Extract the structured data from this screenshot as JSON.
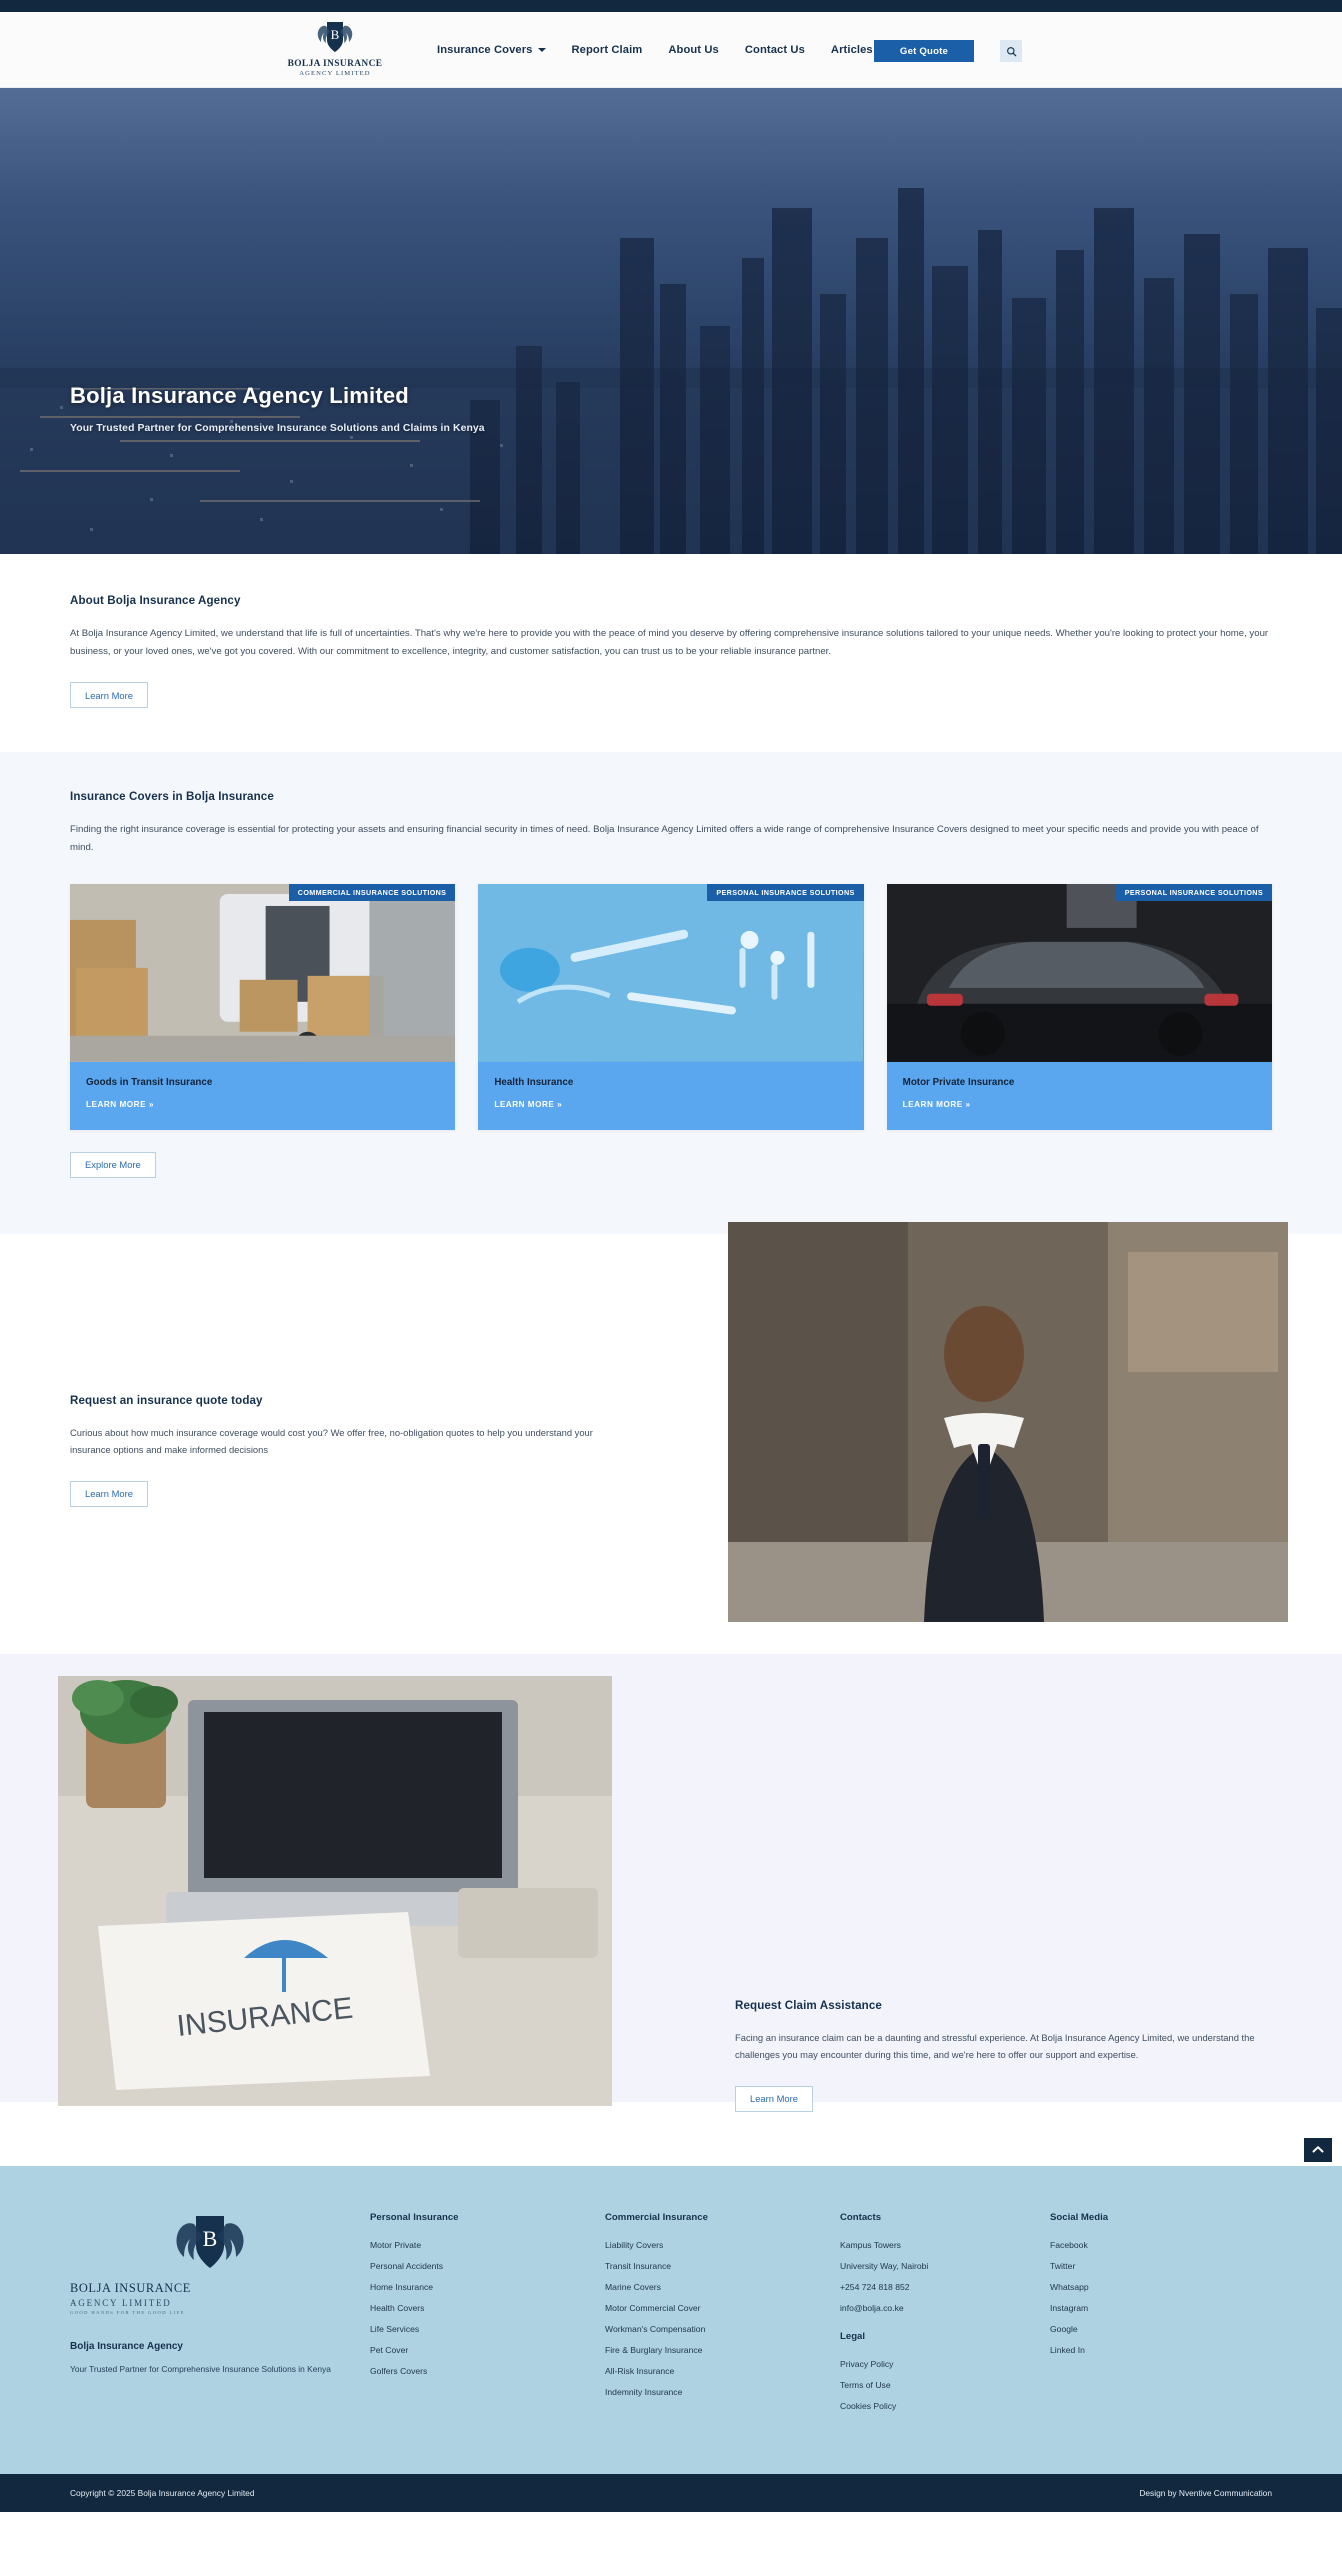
{
  "brand": {
    "logo_line1": "BOLJA INSURANCE",
    "logo_line2": "AGENCY LIMITED",
    "logo_tagline": "GOOD HANDS FOR THE GOOD LIFE",
    "monogram": "B"
  },
  "nav": {
    "items": [
      {
        "label": "Insurance Covers",
        "has_dropdown": true
      },
      {
        "label": "Report Claim",
        "has_dropdown": false
      },
      {
        "label": "About Us",
        "has_dropdown": false
      },
      {
        "label": "Contact Us",
        "has_dropdown": false
      },
      {
        "label": "Articles",
        "has_dropdown": false
      }
    ],
    "quote_button": "Get Quote",
    "search_icon": "search-icon"
  },
  "hero": {
    "title": "Bolja Insurance Agency Limited",
    "subtitle": "Your Trusted Partner for Comprehensive Insurance Solutions and Claims in Kenya"
  },
  "about": {
    "title": "About Bolja Insurance Agency",
    "paragraph": "At Bolja Insurance Agency Limited, we understand that life is full of uncertainties. That's why we're here to provide you with the peace of mind you deserve by offering comprehensive insurance solutions tailored to your unique needs. Whether you're looking to protect your home, your business, or your loved ones, we've got you covered. With our commitment to excellence, integrity, and customer satisfaction, you can trust us to be your reliable insurance partner.",
    "button": "Learn More"
  },
  "covers": {
    "title": "Insurance Covers in Bolja Insurance",
    "paragraph": "Finding the right insurance coverage is essential for protecting your assets and ensuring financial security in times of need. Bolja Insurance Agency Limited offers a wide range of comprehensive Insurance Covers designed to meet your specific needs and provide you with peace of mind.",
    "cards": [
      {
        "badge": "COMMERCIAL INSURANCE SOLUTIONS",
        "title": "Goods in Transit Insurance",
        "link": "LEARN MORE »"
      },
      {
        "badge": "PERSONAL INSURANCE SOLUTIONS",
        "title": "Health Insurance",
        "link": "LEARN MORE »"
      },
      {
        "badge": "PERSONAL INSURANCE SOLUTIONS",
        "title": "Motor Private Insurance",
        "link": "LEARN MORE »"
      }
    ],
    "explore_button": "Explore More"
  },
  "quote": {
    "title": "Request an insurance quote today",
    "paragraph": "Curious about how much insurance coverage would cost you? We offer free, no-obligation quotes to help you understand your insurance options and make informed decisions",
    "button": "Learn More"
  },
  "claim": {
    "title": "Request Claim Assistance",
    "paragraph": "Facing an insurance claim can be a daunting and stressful experience. At Bolja Insurance Agency Limited, we understand the challenges you may encounter during this time, and we're here to offer our support and expertise.",
    "button": "Learn More"
  },
  "footer": {
    "brand_title": "Bolja Insurance Agency",
    "brand_sub": "Your Trusted Partner for Comprehensive Insurance Solutions in Kenya",
    "personal": {
      "heading": "Personal Insurance",
      "links": [
        "Motor Private",
        "Personal Accidents",
        "Home Insurance",
        "Health Covers",
        "Life Services",
        "Pet Cover",
        "Golfers Covers"
      ]
    },
    "commercial": {
      "heading": "Commercial Insurance",
      "links": [
        "Liability Covers",
        "Transit Insurance",
        "Marine Covers",
        "Motor Commercial Cover",
        "Workman's Compensation",
        "Fire & Burglary Insurance",
        "All-Risk Insurance",
        "Indemnity Insurance"
      ]
    },
    "contacts": {
      "heading": "Contacts",
      "links": [
        "Kampus Towers",
        "University Way, Nairobi",
        "+254 724 818 852",
        "info@bolja.co.ke"
      ]
    },
    "legal": {
      "heading": "Legal",
      "links": [
        "Privacy Policy",
        "Terms of Use",
        "Cookies Policy"
      ]
    },
    "social": {
      "heading": "Social Media",
      "links": [
        "Facebook",
        "Twitter",
        "Whatsapp",
        "Instagram",
        "Google",
        "Linked In"
      ]
    },
    "back_to_top_icon": "chevron-up-icon"
  },
  "bottom": {
    "copyright": "Copyright © 2025 Bolja Insurance Agency Limited",
    "credit": "Design by Nventive Communication"
  },
  "colors": {
    "dark_navy": "#12283f",
    "brand_blue": "#1a5fa8",
    "card_blue": "#5aa7ef",
    "footer_blue": "#aed2e2",
    "section_grey": "#f4f7fb",
    "claim_bg": "#f3f4fb"
  }
}
